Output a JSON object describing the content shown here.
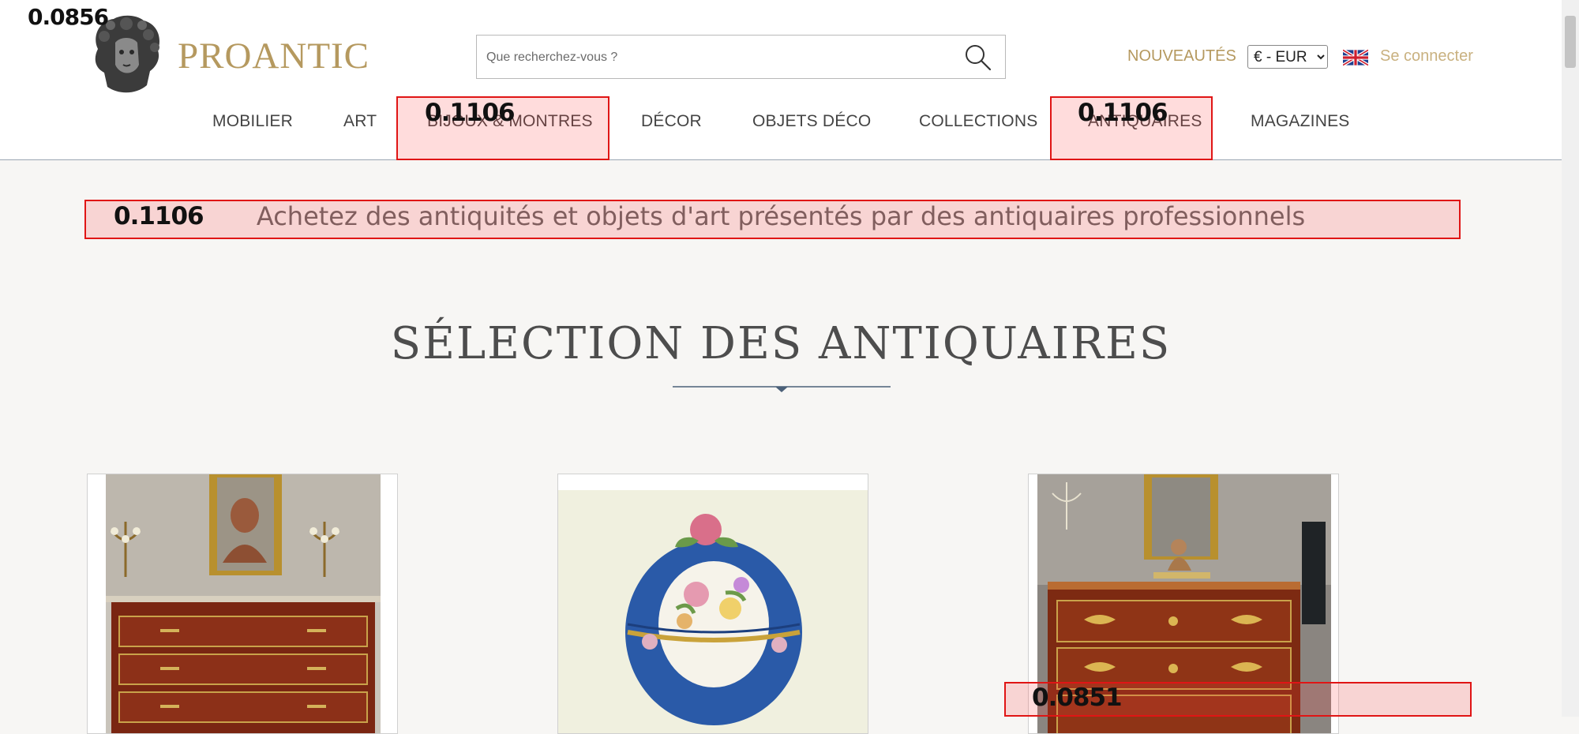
{
  "header": {
    "logo_text": "PROANTIC",
    "search_placeholder": "Que recherchez-vous ?",
    "nouveautes": "NOUVEAUTÉS",
    "currency": "€ - EUR",
    "login": "Se connecter"
  },
  "nav": {
    "items": [
      "MOBILIER",
      "ART",
      "BIJOUX & MONTRES",
      "DÉCOR",
      "OBJETS DÉCO",
      "COLLECTIONS",
      "ANTIQUAIRES",
      "MAGAZINES"
    ]
  },
  "tagline": "Achetez des antiquités et objets d'art présentés par des antiquaires professionnels",
  "selection": {
    "title": "SÉLECTION DES ANTIQUAIRES"
  },
  "overlays": {
    "scores": [
      "0.1106",
      "0.1106",
      "0.1106",
      "0.0851"
    ],
    "corner": "0.0856"
  },
  "colors": {
    "brand_gold": "#b5995f",
    "overlay_red": "#e01515",
    "background": "#f7f6f4"
  },
  "icons": [
    "logo-bust-icon",
    "search-icon",
    "uk-flag-icon",
    "divider-diamond-icon"
  ]
}
